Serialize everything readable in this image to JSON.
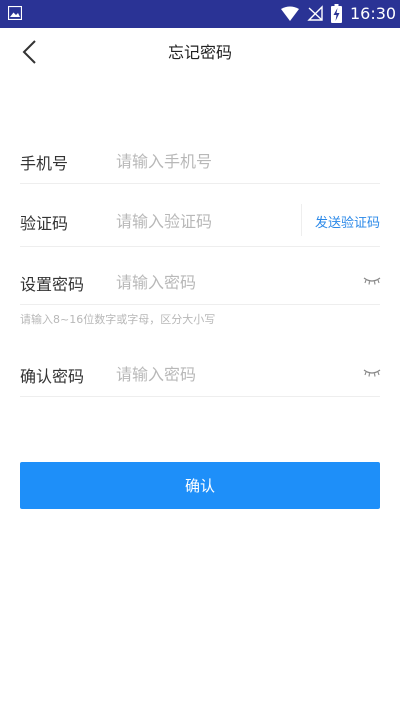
{
  "status_bar": {
    "time": "16:30",
    "icons": [
      "gallery-icon",
      "wifi-icon",
      "no-signal-icon",
      "battery-charging-icon"
    ],
    "background_color": "#2a3395"
  },
  "header": {
    "title": "忘记密码",
    "back_icon": "chevron-left-icon"
  },
  "form": {
    "phone": {
      "label": "手机号",
      "placeholder": "请输入手机号",
      "value": ""
    },
    "code": {
      "label": "验证码",
      "placeholder": "请输入验证码",
      "value": "",
      "send_label": "发送验证码"
    },
    "password": {
      "label": "设置密码",
      "placeholder": "请输入密码",
      "value": "",
      "toggle_icon": "eye-closed-icon"
    },
    "password_hint": "请输入8~16位数字或字母，区分大小写",
    "confirm_password": {
      "label": "确认密码",
      "placeholder": "请输入密码",
      "value": "",
      "toggle_icon": "eye-closed-icon"
    }
  },
  "actions": {
    "confirm_label": "确认",
    "confirm_color": "#1e8ff9",
    "link_color": "#2a88e8"
  }
}
